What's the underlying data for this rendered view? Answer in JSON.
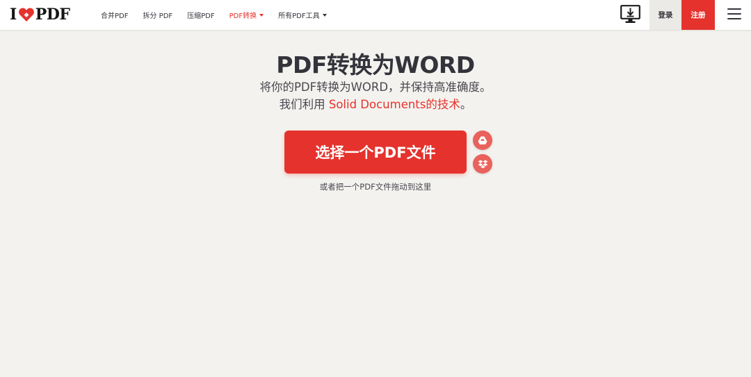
{
  "header": {
    "logo": {
      "left": "I",
      "right": "PDF",
      "heart_color": "#e5322d"
    },
    "nav": [
      {
        "label": "合并PDF"
      },
      {
        "label": "拆分 PDF"
      },
      {
        "label": "压缩PDF"
      },
      {
        "label": "PDF转换",
        "active": true,
        "dropdown": true
      },
      {
        "label": "所有PDF工具",
        "dropdown": true
      }
    ],
    "desktop_icon": "desktop-download-icon",
    "login_label": "登录",
    "signup_label": "注册",
    "menu_icon": "hamburger-menu-icon"
  },
  "main": {
    "title": "PDF转换为WORD",
    "subtitle_line1": "将你的PDF转换为WORD，并保持高准确度。",
    "subtitle_line2_prefix": "我们利用 ",
    "subtitle_line2_link": "Solid Documents的技术",
    "subtitle_line2_suffix": "。",
    "select_button_label": "选择一个PDF文件",
    "google_drive_icon": "google-drive-icon",
    "dropbox_icon": "dropbox-icon",
    "drop_hint": "或者把一个PDF文件拖动到这里"
  },
  "colors": {
    "accent": "#e5322d",
    "background": "#f4f2ee",
    "text": "#33333b"
  }
}
